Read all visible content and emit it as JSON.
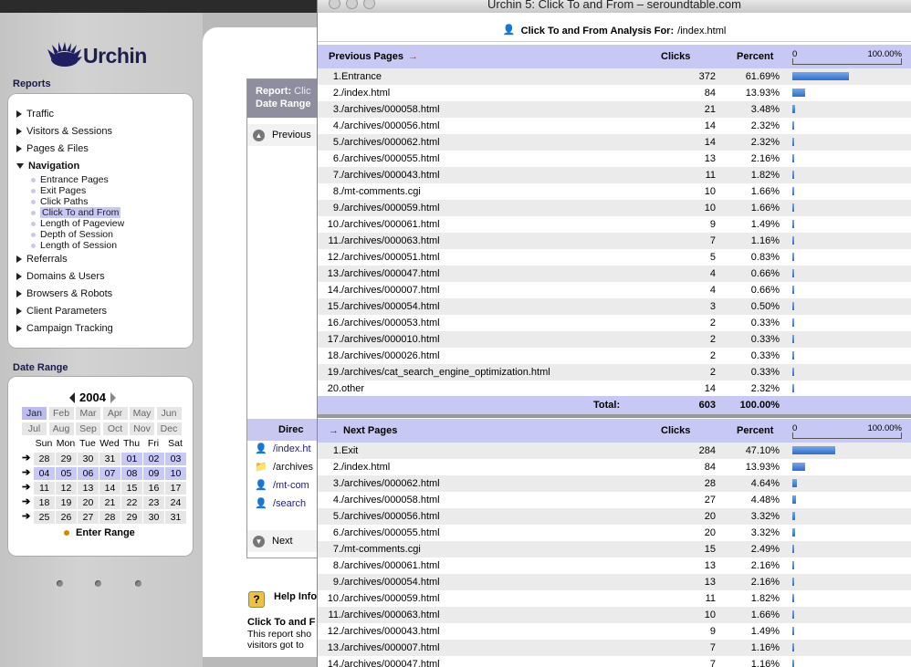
{
  "brand": "Urchin",
  "sidebar": {
    "reports_title": "Reports",
    "items": [
      {
        "label": "Traffic"
      },
      {
        "label": "Visitors & Sessions"
      },
      {
        "label": "Pages & Files"
      },
      {
        "label": "Navigation",
        "expanded": true
      },
      {
        "label": "Referrals"
      },
      {
        "label": "Domains & Users"
      },
      {
        "label": "Browsers & Robots"
      },
      {
        "label": "Client Parameters"
      },
      {
        "label": "Campaign Tracking"
      }
    ],
    "nav_sub": [
      {
        "label": "Entrance Pages"
      },
      {
        "label": "Exit Pages"
      },
      {
        "label": "Click Paths"
      },
      {
        "label": "Click To and From",
        "active": true
      },
      {
        "label": "Length of Pageview"
      },
      {
        "label": "Depth of Session"
      },
      {
        "label": "Length of Session"
      }
    ],
    "date_title": "Date Range",
    "year": "2004",
    "months": [
      "Jan",
      "Feb",
      "Mar",
      "Apr",
      "May",
      "Jun",
      "Jul",
      "Aug",
      "Sep",
      "Oct",
      "Nov",
      "Dec"
    ],
    "selected_month": "Jan",
    "dow": [
      "Sun",
      "Mon",
      "Tue",
      "Wed",
      "Thu",
      "Fri",
      "Sat"
    ],
    "weeks": [
      {
        "days": [
          "28",
          "29",
          "30",
          "31",
          "01",
          "02",
          "03"
        ],
        "sel_from": 4
      },
      {
        "days": [
          "04",
          "05",
          "06",
          "07",
          "08",
          "09",
          "10"
        ],
        "sel_from": 0
      },
      {
        "days": [
          "11",
          "12",
          "13",
          "14",
          "15",
          "16",
          "17"
        ],
        "sel_from": 7
      },
      {
        "days": [
          "18",
          "19",
          "20",
          "21",
          "22",
          "23",
          "24"
        ],
        "sel_from": 7
      },
      {
        "days": [
          "25",
          "26",
          "27",
          "28",
          "29",
          "30",
          "31"
        ],
        "sel_from": 7
      }
    ],
    "enter_range": "Enter Range"
  },
  "report": {
    "label_report": "Report:",
    "report_value": "Clic",
    "label_date": "Date Range",
    "previous": "Previous",
    "next": "Next",
    "direct": "Direc",
    "links": [
      "/index.ht",
      "/archives",
      "/mt-com",
      "/search"
    ],
    "help_title": "Help Info",
    "ctf_title": "Click To and F",
    "help_line1": "This report sho",
    "help_line2": "visitors got to"
  },
  "popup": {
    "window_title": "Urchin 5: Click To and From – seroundtable.com",
    "analysis_label": "Click To and From Analysis For:",
    "analysis_page": "/index.html",
    "prev_title": "Previous Pages",
    "next_title": "Next Pages",
    "col_clicks": "Clicks",
    "col_percent": "Percent",
    "scale_lo": "0",
    "scale_hi": "100.00%",
    "total_label": "Total:",
    "total_clicks": "603",
    "total_percent": "100.00%"
  },
  "previous_pages": [
    {
      "n": "1.",
      "name": "Entrance",
      "clicks": "372",
      "pct": "61.69%",
      "frac": 0.6169
    },
    {
      "n": "2.",
      "name": "/index.html",
      "clicks": "84",
      "pct": "13.93%",
      "frac": 0.1393
    },
    {
      "n": "3.",
      "name": "/archives/000058.html",
      "clicks": "21",
      "pct": "3.48%",
      "frac": 0.0348
    },
    {
      "n": "4.",
      "name": "/archives/000056.html",
      "clicks": "14",
      "pct": "2.32%",
      "frac": 0.0232
    },
    {
      "n": "5.",
      "name": "/archives/000062.html",
      "clicks": "14",
      "pct": "2.32%",
      "frac": 0.0232
    },
    {
      "n": "6.",
      "name": "/archives/000055.html",
      "clicks": "13",
      "pct": "2.16%",
      "frac": 0.0216
    },
    {
      "n": "7.",
      "name": "/archives/000043.html",
      "clicks": "11",
      "pct": "1.82%",
      "frac": 0.0182
    },
    {
      "n": "8.",
      "name": "/mt-comments.cgi",
      "clicks": "10",
      "pct": "1.66%",
      "frac": 0.0166
    },
    {
      "n": "9.",
      "name": "/archives/000059.html",
      "clicks": "10",
      "pct": "1.66%",
      "frac": 0.0166
    },
    {
      "n": "10.",
      "name": "/archives/000061.html",
      "clicks": "9",
      "pct": "1.49%",
      "frac": 0.0149
    },
    {
      "n": "11.",
      "name": "/archives/000063.html",
      "clicks": "7",
      "pct": "1.16%",
      "frac": 0.0116
    },
    {
      "n": "12.",
      "name": "/archives/000051.html",
      "clicks": "5",
      "pct": "0.83%",
      "frac": 0.0083
    },
    {
      "n": "13.",
      "name": "/archives/000047.html",
      "clicks": "4",
      "pct": "0.66%",
      "frac": 0.0066
    },
    {
      "n": "14.",
      "name": "/archives/000007.html",
      "clicks": "4",
      "pct": "0.66%",
      "frac": 0.0066
    },
    {
      "n": "15.",
      "name": "/archives/000054.html",
      "clicks": "3",
      "pct": "0.50%",
      "frac": 0.005
    },
    {
      "n": "16.",
      "name": "/archives/000053.html",
      "clicks": "2",
      "pct": "0.33%",
      "frac": 0.0033
    },
    {
      "n": "17.",
      "name": "/archives/000010.html",
      "clicks": "2",
      "pct": "0.33%",
      "frac": 0.0033
    },
    {
      "n": "18.",
      "name": "/archives/000026.html",
      "clicks": "2",
      "pct": "0.33%",
      "frac": 0.0033
    },
    {
      "n": "19.",
      "name": "/archives/cat_search_engine_optimization.html",
      "clicks": "2",
      "pct": "0.33%",
      "frac": 0.0033
    },
    {
      "n": "20.",
      "name": "other",
      "clicks": "14",
      "pct": "2.32%",
      "frac": 0.0232
    }
  ],
  "next_pages": [
    {
      "n": "1.",
      "name": "Exit",
      "clicks": "284",
      "pct": "47.10%",
      "frac": 0.471
    },
    {
      "n": "2.",
      "name": "/index.html",
      "clicks": "84",
      "pct": "13.93%",
      "frac": 0.1393
    },
    {
      "n": "3.",
      "name": "/archives/000062.html",
      "clicks": "28",
      "pct": "4.64%",
      "frac": 0.0464
    },
    {
      "n": "4.",
      "name": "/archives/000058.html",
      "clicks": "27",
      "pct": "4.48%",
      "frac": 0.0448
    },
    {
      "n": "5.",
      "name": "/archives/000056.html",
      "clicks": "20",
      "pct": "3.32%",
      "frac": 0.0332
    },
    {
      "n": "6.",
      "name": "/archives/000055.html",
      "clicks": "20",
      "pct": "3.32%",
      "frac": 0.0332
    },
    {
      "n": "7.",
      "name": "/mt-comments.cgi",
      "clicks": "15",
      "pct": "2.49%",
      "frac": 0.0249
    },
    {
      "n": "8.",
      "name": "/archives/000061.html",
      "clicks": "13",
      "pct": "2.16%",
      "frac": 0.0216
    },
    {
      "n": "9.",
      "name": "/archives/000054.html",
      "clicks": "13",
      "pct": "2.16%",
      "frac": 0.0216
    },
    {
      "n": "10.",
      "name": "/archives/000059.html",
      "clicks": "11",
      "pct": "1.82%",
      "frac": 0.0182
    },
    {
      "n": "11.",
      "name": "/archives/000063.html",
      "clicks": "10",
      "pct": "1.66%",
      "frac": 0.0166
    },
    {
      "n": "12.",
      "name": "/archives/000043.html",
      "clicks": "9",
      "pct": "1.49%",
      "frac": 0.0149
    },
    {
      "n": "13.",
      "name": "/archives/000007.html",
      "clicks": "7",
      "pct": "1.16%",
      "frac": 0.0116
    },
    {
      "n": "14.",
      "name": "/archives/000047.html",
      "clicks": "7",
      "pct": "1.16%",
      "frac": 0.0116
    }
  ],
  "colors": {
    "header_band": "#c8c8f5",
    "bar": "#2e6ec8",
    "brand": "#1e1e50"
  }
}
